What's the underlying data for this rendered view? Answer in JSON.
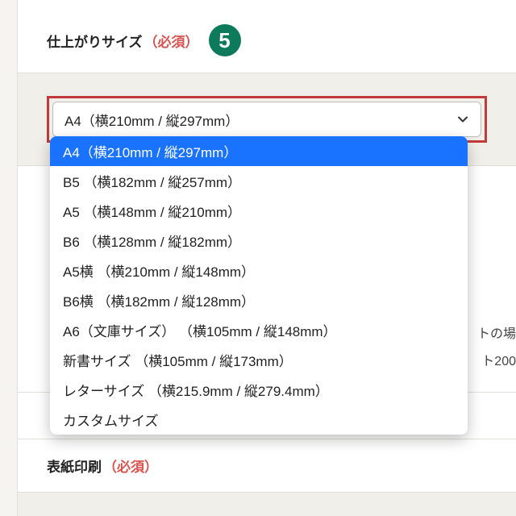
{
  "section1": {
    "title": "仕上がりサイズ",
    "required": "（必須）",
    "badge": "5"
  },
  "select": {
    "value": "A4（横210mm / 縦297mm）",
    "options": [
      "A4（横210mm / 縦297mm）",
      "B5 （横182mm / 縦257mm）",
      "A5 （横148mm / 縦210mm）",
      "B6 （横128mm / 縦182mm）",
      "A5横 （横210mm / 縦148mm）",
      "B6横 （横182mm / 縦128mm）",
      "A6（文庫サイズ） （横105mm / 縦148mm）",
      "新書サイズ （横105mm / 縦173mm）",
      "レターサイズ （横215.9mm / 縦279.4mm）",
      "カスタムサイズ"
    ],
    "selected_index": 0
  },
  "bg_fragments": {
    "line1": "トの場",
    "line2": "ト200"
  },
  "section2": {
    "title": "表紙印刷",
    "required": "（必須）"
  }
}
